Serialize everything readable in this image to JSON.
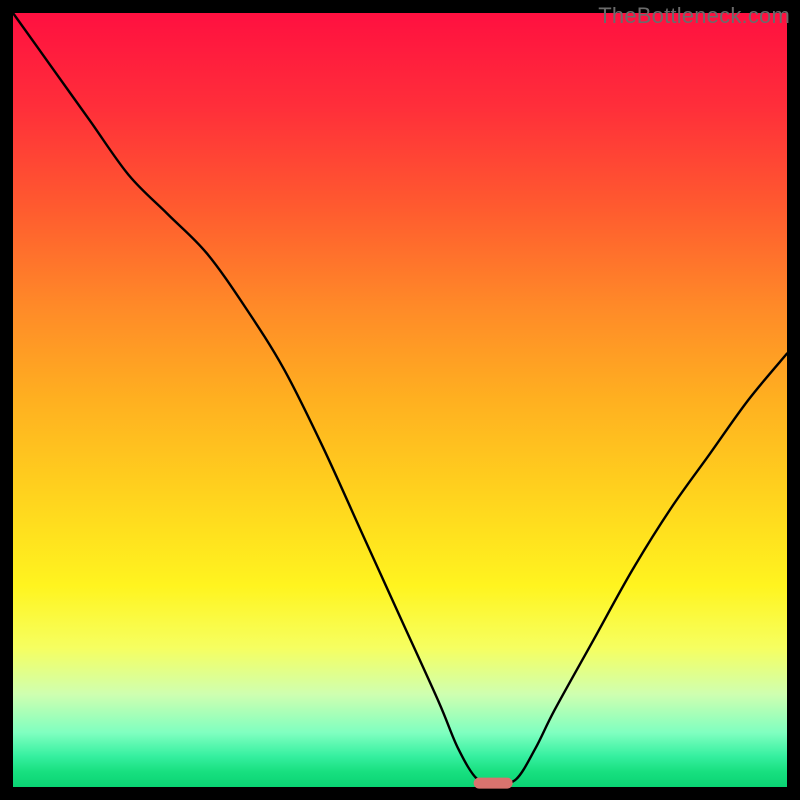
{
  "watermark": {
    "text": "TheBottleneck.com"
  },
  "chart_data": {
    "type": "line",
    "title": "",
    "xlabel": "",
    "ylabel": "",
    "xlim": [
      0,
      100
    ],
    "ylim": [
      0,
      100
    ],
    "grid": false,
    "legend": false,
    "background_gradient": {
      "top": "#ff1040",
      "mid": "#ffd21e",
      "bottom": "#0ad373"
    },
    "series": [
      {
        "name": "bottleneck-curve",
        "color": "#000000",
        "x": [
          0,
          5,
          10,
          15,
          20,
          25,
          30,
          35,
          40,
          45,
          50,
          55,
          57.5,
          60,
          62.5,
          65,
          67.5,
          70,
          75,
          80,
          85,
          90,
          95,
          100
        ],
        "y": [
          100,
          93,
          86,
          79,
          74,
          69,
          62,
          54,
          44,
          33,
          22,
          11,
          5,
          1,
          0.5,
          1,
          5,
          10,
          19,
          28,
          36,
          43,
          50,
          56
        ]
      }
    ],
    "marker": {
      "name": "optimal-point",
      "color": "#d9736e",
      "x": 62,
      "y": 0.5,
      "width_pct": 5,
      "height_pct": 1.4
    }
  }
}
